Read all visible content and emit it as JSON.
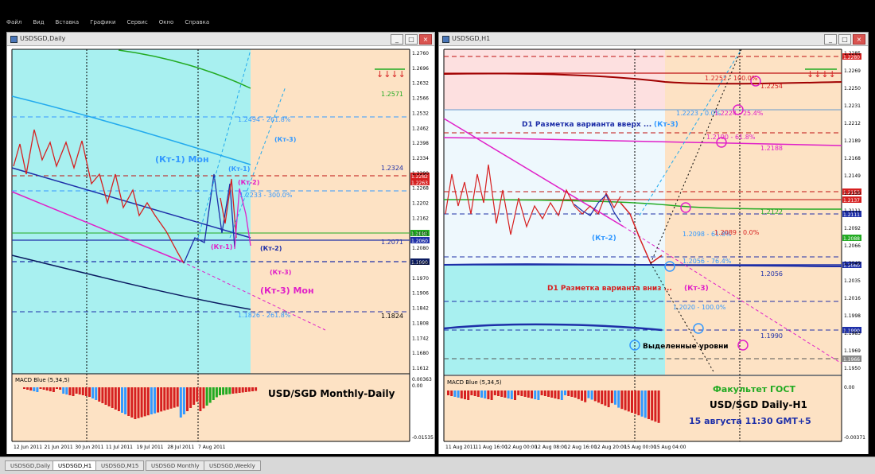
{
  "app": {
    "menu": [
      "Файл",
      "Вид",
      "Вставка",
      "Графики",
      "Сервис",
      "Окно",
      "Справка"
    ],
    "tabs": [
      "USDSGD,Daily",
      "USDSGD,H1",
      "USDSGD,M15",
      "USDSGD Monthly",
      "USDSGD,Weekly"
    ],
    "active_tab": 1
  },
  "left": {
    "title": "USDSGD,Daily",
    "price_labels": [
      "1.2760",
      "1.2696",
      "1.2632",
      "1.2566",
      "1.2532",
      "1.2462",
      "1.2398",
      "1.2334",
      "1.2290",
      "1.2268",
      "1.2202",
      "1.2162",
      "1.2101",
      "1.2080",
      "1.2036",
      "1.1970",
      "1.1906",
      "1.1842",
      "1.1808",
      "1.1742",
      "1.1680",
      "1.1612"
    ],
    "date_labels": [
      "12 Jun 2011",
      "21 Jun 2011",
      "30 Jun 2011",
      "11 Jul 2011",
      "19 Jul 2011",
      "28 Jul 2011",
      "7 Aug 2011"
    ],
    "macd_label": "MACD Blue (5,34,5)",
    "macd_scale": [
      "0.00363",
      "0.00",
      "-0.01535"
    ],
    "arrows": "↓↓↓↓",
    "annotations": {
      "kt1_mon": "(Кт-1) Мон",
      "kt3_mon": "(Кт-3) Мон",
      "kt3_a": "(Кт-3)",
      "kt1_b": "(Кт-1)",
      "kt2_a": "(Кт-2)",
      "kt1_c": "(Кт-1)",
      "kt2_b": "(Кт-2)",
      "kt3_b": "(Кт-3)",
      "lvl_12571": "1.2571",
      "lvl_12494": "1.2494 - 261.8%",
      "lvl_12324": "1.2324",
      "lvl_12233": "1.2233 - 300.0%",
      "lvl_12071": "1.2071",
      "lvl_11826": "1.1826 - 261.8%",
      "lvl_11824": "1.1824",
      "caption": "USD/SGD Monthly-Daily"
    },
    "tags": {
      "t1": "1.2282",
      "t2": "1.2263",
      "t3": "1.2080",
      "t4": "1.2060",
      "t5": "1.1990"
    }
  },
  "right": {
    "title": "USDSGD,H1",
    "price_labels": [
      "1.2285",
      "1.2269",
      "1.2250",
      "1.2231",
      "1.2212",
      "1.2189",
      "1.2168",
      "1.2149",
      "1.2130",
      "1.2111",
      "1.2092",
      "1.2066",
      "1.2049",
      "1.2035",
      "1.2016",
      "1.1998",
      "1.1983",
      "1.1969",
      "1.1950"
    ],
    "date_labels": [
      "11 Aug 2011",
      "11 Aug 16:00",
      "12 Aug 00:00",
      "12 Aug 08:00",
      "12 Aug 16:00",
      "12 Aug 20:00",
      "15 Aug 00:00",
      "15 Aug 04:00"
    ],
    "macd_label": "MACD Blue (5,34,5)",
    "macd_scale": [
      "0.00",
      "-0.00371"
    ],
    "arrows": "↓↓↓↓",
    "annotations": {
      "up_title": "D1 Разметка варианта вверх ...",
      "up_kt3": "(Кт-3)",
      "down_title": "D1 Разметка варианта вниз ...",
      "down_kt3": "(Кт-3)",
      "kt2": "(Кт-2)",
      "lvl_12252": "1.2252 - 100.0%",
      "lvl_12254": "1.2254",
      "lvl_12223": "1.2223 - 0.0%",
      "lvl_12224": "1.2224 - 25.4%",
      "lvl_12190": "1.2190 - 61.8%",
      "lvl_12188": "1.2188",
      "lvl_12122": "1.2122",
      "lvl_12098": "1.2098 - 61.8%",
      "lvl_12089": "1.2089 - 0.0%",
      "lvl_12056a": "1.2056 - 76.4%",
      "lvl_12056b": "1.2056",
      "lvl_12020": "1.2020 - 100.0%",
      "lvl_11990": "1.1990",
      "selected": "Выделенные уровни",
      "fac": "Факультет ГОСТ",
      "caption": "USD/SGD Daily-H1",
      "date": "15 августа 11:30   GMT+5"
    },
    "tags": {
      "t1": "1.2280",
      "t2": "1.2153",
      "t3": "1.2137",
      "t4": "1.2111",
      "t5": "1.2088",
      "t6": "1.2060",
      "t7": "1.1990",
      "t8": "1.1966"
    }
  },
  "colors": {
    "cyan_zone": "#a8f0f0",
    "peach_zone": "#fde2c4",
    "pink_zone": "#fde0e0",
    "red": "#d62020",
    "blue": "#1e2fa8",
    "magenta": "#e020c8",
    "green": "#22aa22",
    "navy": "#000080"
  }
}
